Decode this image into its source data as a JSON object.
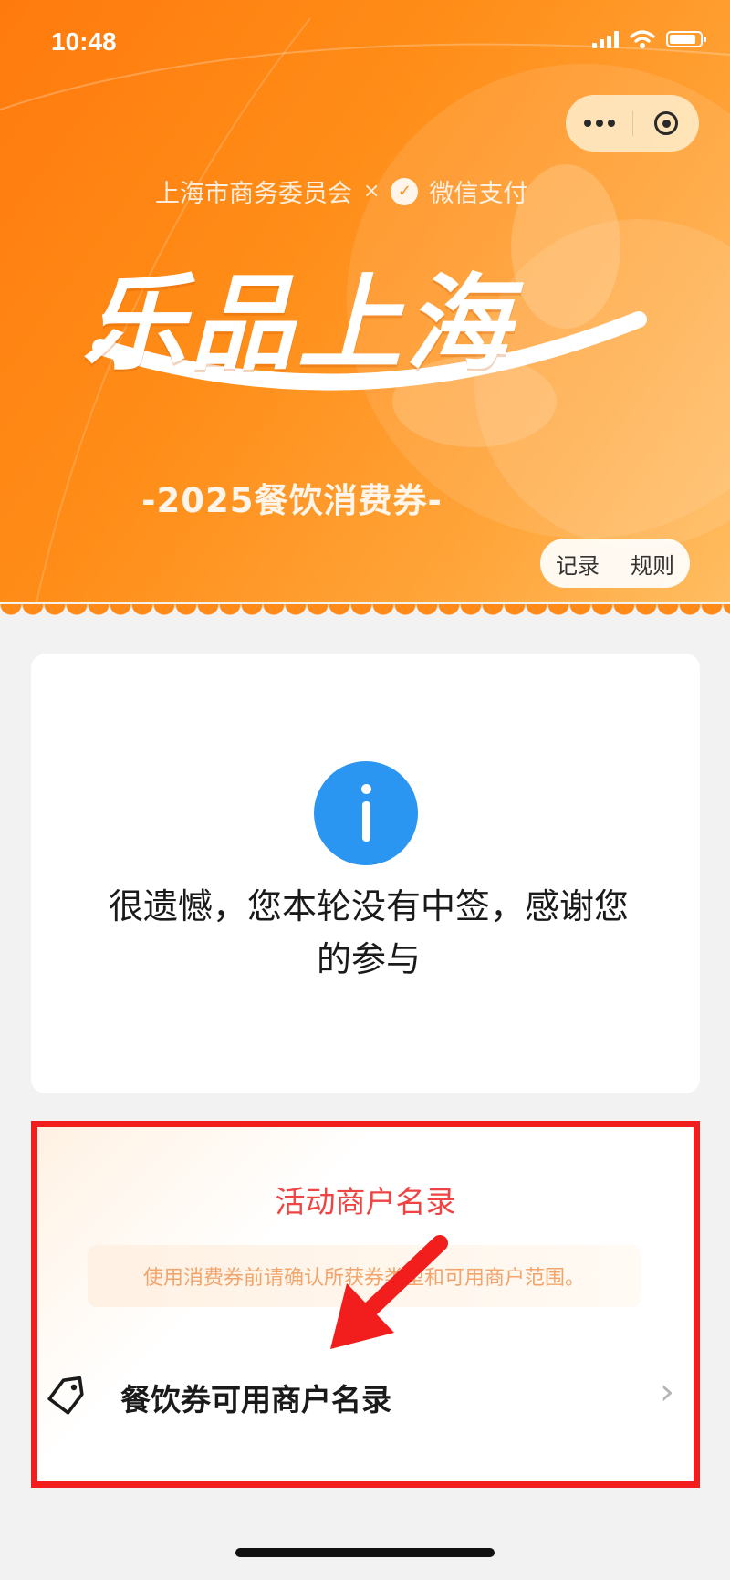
{
  "status_bar": {
    "time": "10:48",
    "battery_level_percent": 80
  },
  "banner": {
    "sponsor_left": "上海市商务委员会",
    "sponsor_sep": "×",
    "sponsor_right": "微信支付",
    "title": "乐品上海",
    "subtitle": "-2025餐饮消费券-",
    "links": {
      "records": "记录",
      "rules": "规则"
    },
    "colors": {
      "primary": "#ff7a0d",
      "secondary": "#ffbd62"
    }
  },
  "result": {
    "icon": "info-icon",
    "message": "很遗憾，您本轮没有中签，感谢您的参与",
    "icon_color": "#2b95f2"
  },
  "merchant_section": {
    "title": "活动商户名录",
    "notice": "使用消费券前请确认所获券类型和可用商户范围。",
    "item_label": "餐饮券可用商户名录",
    "title_color": "#f04444",
    "highlight_color": "#f21d1d"
  }
}
